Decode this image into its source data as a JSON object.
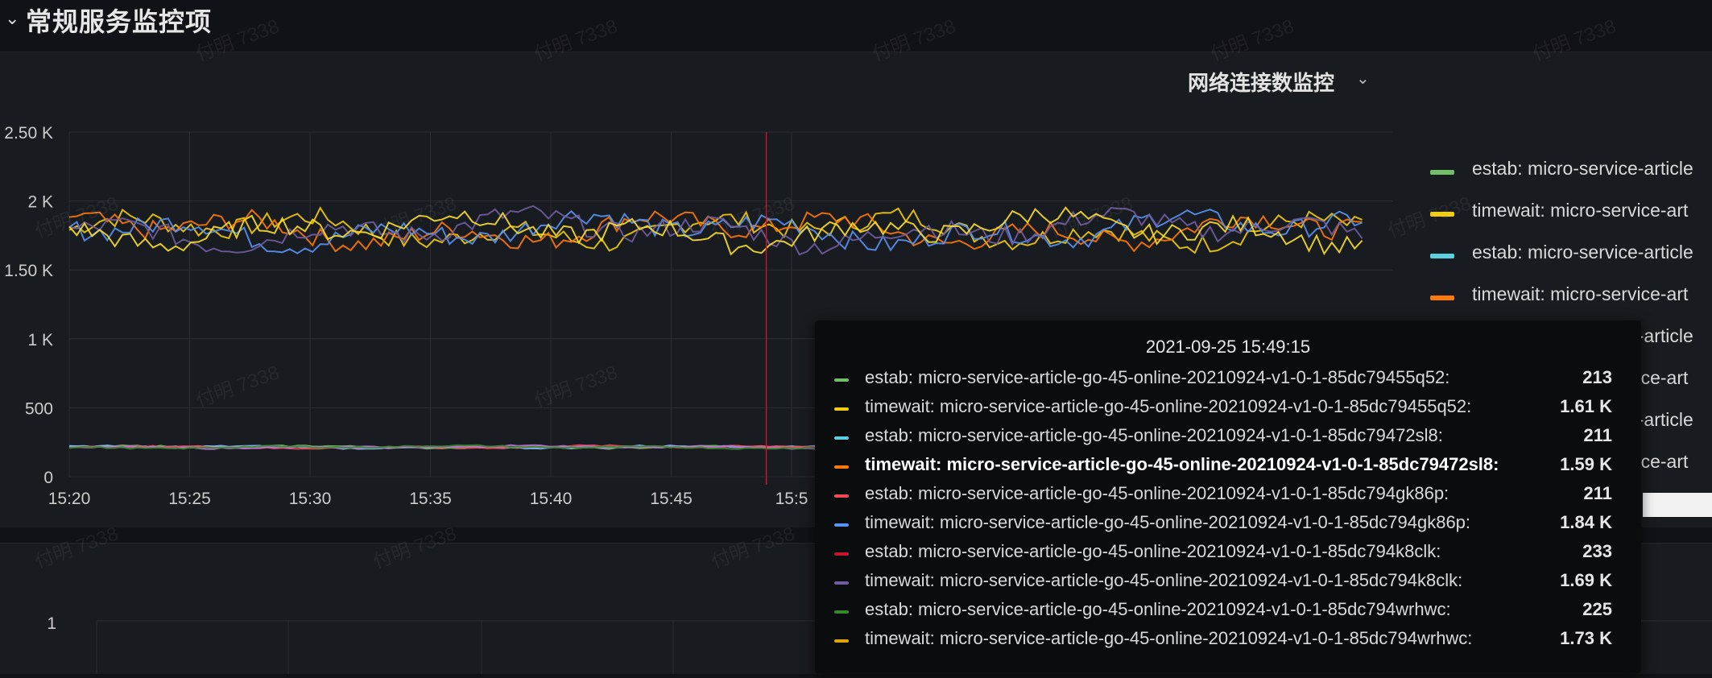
{
  "row": {
    "title": "常规服务监控项",
    "chevron_icon": "chevron-down-icon"
  },
  "panel": {
    "title": "网络连接数监控",
    "menu_icon": "chevron-down-icon"
  },
  "watermark_text": "付明 7338",
  "chart_data": {
    "type": "line",
    "y_ticks": [
      "2.50 K",
      "2 K",
      "1.50 K",
      "1 K",
      "500",
      "0"
    ],
    "y_tick_values": [
      2500,
      2000,
      1500,
      1000,
      500,
      0
    ],
    "ylim": [
      0,
      2500
    ],
    "x_ticks": [
      "15:20",
      "15:25",
      "15:30",
      "15:35",
      "15:40",
      "15:45",
      "15:5"
    ],
    "xlim_minutes": [
      0,
      54
    ],
    "grid": true,
    "cursor_minute": 29.25,
    "series_groups": [
      {
        "kind": "timewait",
        "level": 1790,
        "amplitude": 120
      },
      {
        "kind": "estab",
        "level": 215,
        "amplitude": 10
      }
    ],
    "series_colors": [
      "#73bf69",
      "#f2cc0c",
      "#8ab8ff",
      "#ff780a",
      "#f2495c",
      "#5794f2",
      "#b877d9",
      "#705da0",
      "#37872d",
      "#fade2a"
    ]
  },
  "legend": {
    "items": [
      {
        "label": "estab: micro-service-article",
        "color": "#73bf69"
      },
      {
        "label": "timewait: micro-service-art",
        "color": "#f2cc0c"
      },
      {
        "label": "estab: micro-service-article",
        "color": "#5bd1e0"
      },
      {
        "label": "timewait: micro-service-art",
        "color": "#ff780a"
      },
      {
        "label": "estab: micro-service-article",
        "color": "#f2495c"
      },
      {
        "label": "timewait: micro-service-art",
        "color": "#5794f2"
      },
      {
        "label": "estab: micro-service-article",
        "color": "#b877d9"
      },
      {
        "label": "timewait: micro-service-art",
        "color": "#705da0"
      }
    ]
  },
  "panel2": {
    "y_tick": "1"
  },
  "tooltip": {
    "time": "2021-09-25 15:49:15",
    "rows": [
      {
        "label": "estab: micro-service-article-go-45-online-20210924-v1-0-1-85dc79455q52:",
        "value": "213",
        "color": "#73bf69"
      },
      {
        "label": "timewait: micro-service-article-go-45-online-20210924-v1-0-1-85dc79455q52:",
        "value": "1.61 K",
        "color": "#f2cc0c"
      },
      {
        "label": "estab: micro-service-article-go-45-online-20210924-v1-0-1-85dc79472sl8:",
        "value": "211",
        "color": "#5bd1e0"
      },
      {
        "label": "timewait: micro-service-article-go-45-online-20210924-v1-0-1-85dc79472sl8:",
        "value": "1.59 K",
        "color": "#ff780a"
      },
      {
        "label": "estab: micro-service-article-go-45-online-20210924-v1-0-1-85dc794gk86p:",
        "value": "211",
        "color": "#f2495c"
      },
      {
        "label": "timewait: micro-service-article-go-45-online-20210924-v1-0-1-85dc794gk86p:",
        "value": "1.84 K",
        "color": "#5794f2"
      },
      {
        "label": "estab: micro-service-article-go-45-online-20210924-v1-0-1-85dc794k8clk:",
        "value": "233",
        "color": "#c4162a"
      },
      {
        "label": "timewait: micro-service-article-go-45-online-20210924-v1-0-1-85dc794k8clk:",
        "value": "1.69 K",
        "color": "#705da0"
      },
      {
        "label": "estab: micro-service-article-go-45-online-20210924-v1-0-1-85dc794wrhwc:",
        "value": "225",
        "color": "#37872d"
      },
      {
        "label": "timewait: micro-service-article-go-45-online-20210924-v1-0-1-85dc794wrhwc:",
        "value": "1.73 K",
        "color": "#e0a400"
      }
    ],
    "active_index": 3
  }
}
